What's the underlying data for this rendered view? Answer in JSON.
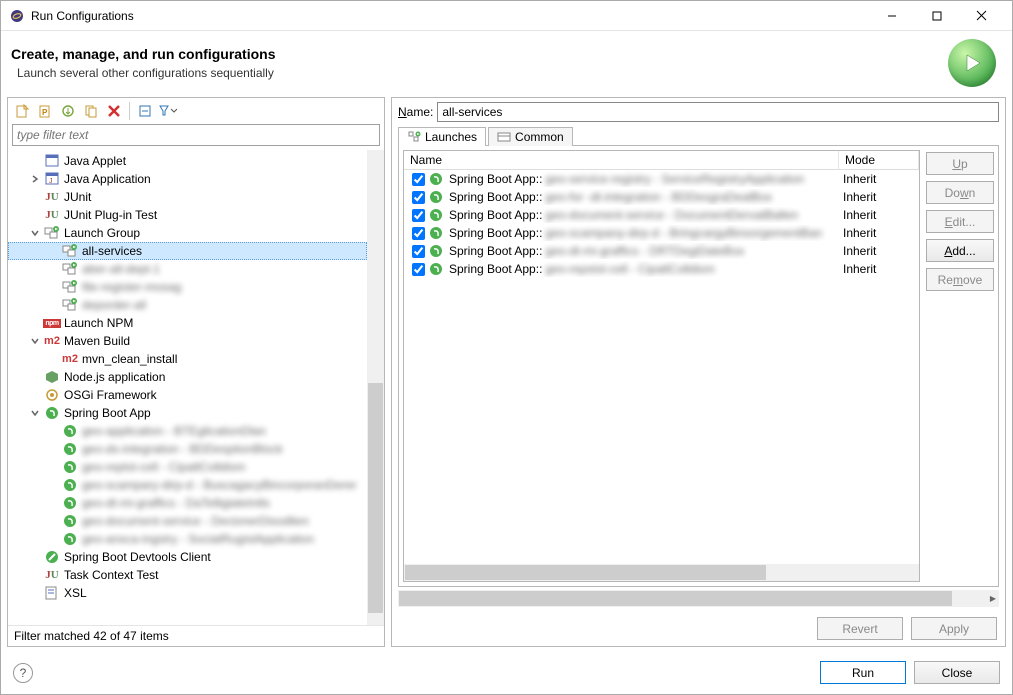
{
  "window": {
    "title": "Run Configurations"
  },
  "header": {
    "title": "Create, manage, and run configurations",
    "subtitle": "Launch several other configurations sequentially"
  },
  "filter_placeholder": "type filter text",
  "tree": [
    {
      "label": "Java Applet",
      "level": 0,
      "icon": "applet",
      "twist": "none"
    },
    {
      "label": "Java Application",
      "level": 0,
      "icon": "java-app",
      "twist": "closed"
    },
    {
      "label": "JUnit",
      "level": 0,
      "icon": "junit",
      "twist": "none"
    },
    {
      "label": "JUnit Plug-in Test",
      "level": 0,
      "icon": "junit",
      "twist": "none"
    },
    {
      "label": "Launch Group",
      "level": 0,
      "icon": "launch-group",
      "twist": "open"
    },
    {
      "label": "all-services",
      "level": 1,
      "icon": "launch-group",
      "selected": true
    },
    {
      "label": "aber-all-dept-1",
      "level": 1,
      "icon": "launch-group",
      "blur": true
    },
    {
      "label": "file-register-mosag",
      "level": 1,
      "icon": "launch-group",
      "blur": true
    },
    {
      "label": "deporder-all",
      "level": 1,
      "icon": "launch-group",
      "blur": true
    },
    {
      "label": "Launch NPM",
      "level": 0,
      "icon": "npm",
      "twist": "none"
    },
    {
      "label": "Maven Build",
      "level": 0,
      "icon": "m2",
      "twist": "open"
    },
    {
      "label": "mvn_clean_install",
      "level": 1,
      "icon": "m2"
    },
    {
      "label": "Node.js application",
      "level": 0,
      "icon": "node",
      "twist": "none"
    },
    {
      "label": "OSGi Framework",
      "level": 0,
      "icon": "osgi",
      "twist": "none"
    },
    {
      "label": "Spring Boot App",
      "level": 0,
      "icon": "spring",
      "twist": "open"
    },
    {
      "label": "geo-application - BTEglicationDlan",
      "level": 1,
      "icon": "spring",
      "blur": true
    },
    {
      "label": "geo-ds-integration - BDDesptionBlock",
      "level": 1,
      "icon": "spring",
      "blur": true
    },
    {
      "label": "geo-reptst-cell - CipatlColldism",
      "level": 1,
      "icon": "spring",
      "blur": true
    },
    {
      "label": "geo-scampary-dirp-d - BuscagacyBincorporanDerer",
      "level": 1,
      "icon": "spring",
      "blur": true
    },
    {
      "label": "geo-dt-mi-graffics - DaTelligiateIntls",
      "level": 1,
      "icon": "spring",
      "blur": true
    },
    {
      "label": "geo-document-service - DecionerDisodlien",
      "level": 1,
      "icon": "spring",
      "blur": true
    },
    {
      "label": "geo-ansca-ingstry - SociatRugistApplication",
      "level": 1,
      "icon": "spring",
      "blur": true
    },
    {
      "label": "Spring Boot Devtools Client",
      "level": 0,
      "icon": "spring-dev",
      "twist": "none"
    },
    {
      "label": "Task Context Test",
      "level": 0,
      "icon": "junit",
      "twist": "none"
    },
    {
      "label": "XSL",
      "level": 0,
      "icon": "xsl",
      "twist": "none"
    }
  ],
  "status_text": "Filter matched 42 of 47 items",
  "name": {
    "label": "Name:",
    "value": "all-services"
  },
  "tabs": [
    {
      "label": "Launches",
      "active": true
    },
    {
      "label": "Common",
      "active": false
    }
  ],
  "table": {
    "columns": {
      "name": "Name",
      "mode": "Mode"
    },
    "rows": [
      {
        "prefix": "Spring Boot App::",
        "detail": "geo-service-registry - ServiceRegistryApplication",
        "mode": "Inherit"
      },
      {
        "prefix": "Spring Boot App::",
        "detail": "geo-for -dt-integration - BDDesgraDealBox",
        "mode": "Inherit"
      },
      {
        "prefix": "Spring Boot App::",
        "detail": "geo-document-service - DocumentDervatBallen",
        "mode": "Inherit"
      },
      {
        "prefix": "Spring Boot App::",
        "detail": "geo-scampany-dirp-d - BringcargyBinsorgementBan",
        "mode": "Inherit"
      },
      {
        "prefix": "Spring Boot App::",
        "detail": "geo-dt-mi-graffics - DRTDegiDateBox",
        "mode": "Inherit"
      },
      {
        "prefix": "Spring Boot App::",
        "detail": "geo-repstst-cell - CipatlColldism",
        "mode": "Inherit"
      }
    ]
  },
  "side_buttons": {
    "up": "Up",
    "down": "Down",
    "edit": "Edit...",
    "add": "Add...",
    "remove": "Remove"
  },
  "bottom": {
    "revert": "Revert",
    "apply": "Apply"
  },
  "footer": {
    "run": "Run",
    "close": "Close"
  }
}
